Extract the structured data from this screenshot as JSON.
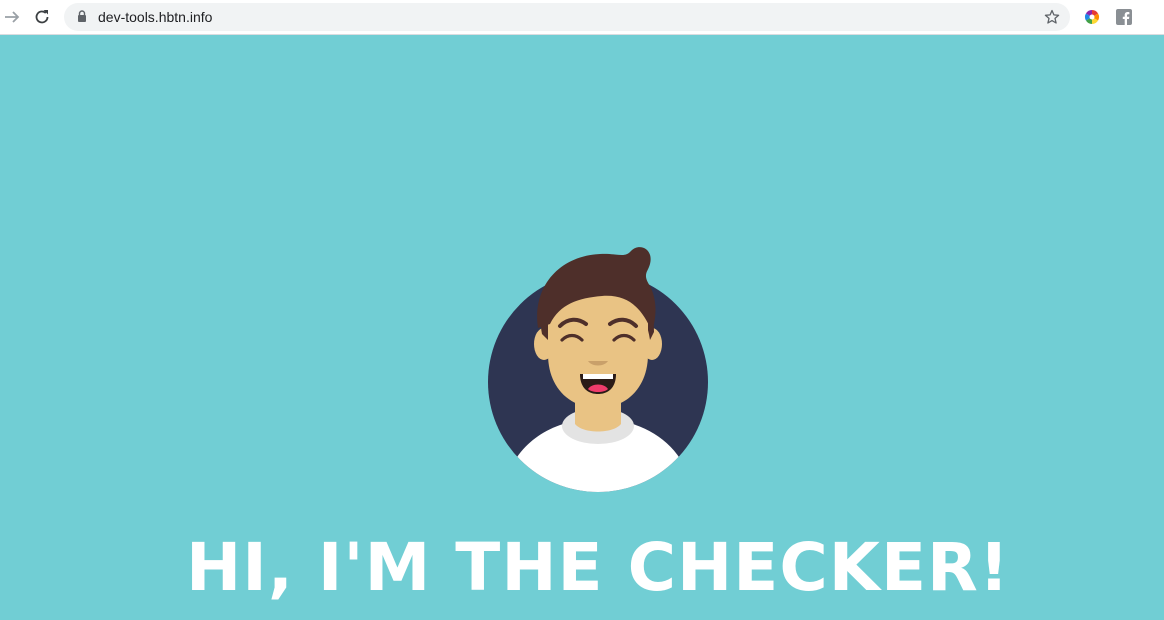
{
  "browser": {
    "url": "dev-tools.hbtn.info",
    "icons": {
      "forward": "forward-arrow-icon",
      "reload": "reload-icon",
      "lock": "lock-icon",
      "bookmark": "star-icon",
      "extension_color": "color-wheel-icon",
      "extension_facebook": "facebook-icon"
    }
  },
  "page": {
    "background_color": "#71ced4",
    "headline": "HI, I'M THE CHECKER!",
    "avatar_colors": {
      "circle": "#2e3552",
      "skin": "#e9c384",
      "hair": "#4e2f2a",
      "shirt": "#ffffff",
      "tongue": "#ef3c6b"
    }
  }
}
